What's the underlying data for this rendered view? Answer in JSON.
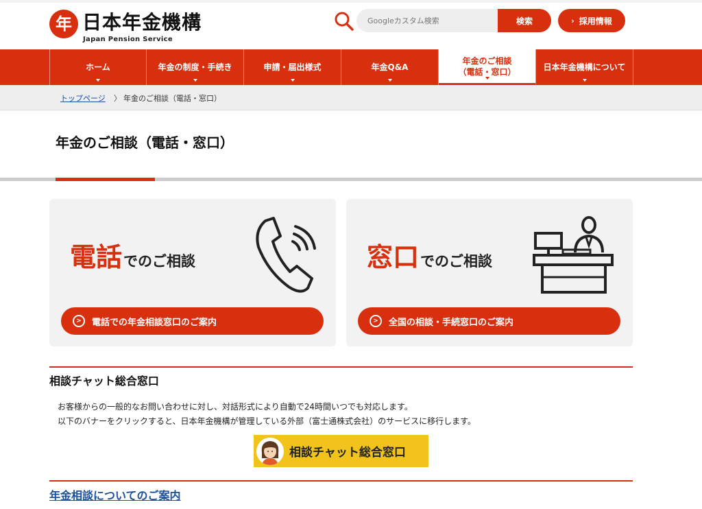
{
  "header": {
    "logo_text": "日本年金機構",
    "logo_text_en": "Japan Pension Service",
    "logo_mark_char": "年",
    "search_placeholder": "Googleカスタム検索",
    "search_button": "検索",
    "recruit_button": "採用情報"
  },
  "nav": {
    "items": [
      {
        "label": "ホーム"
      },
      {
        "label": "年金の制度・手続き"
      },
      {
        "label": "申請・届出様式"
      },
      {
        "label": "年金Q&A"
      },
      {
        "label": "年金のご相談",
        "label2": "（電話・窓口）"
      },
      {
        "label": "日本年金機構について"
      }
    ]
  },
  "breadcrumb": {
    "home": "トップページ",
    "separator": "〉",
    "current": "年金のご相談（電話・窓口）"
  },
  "page": {
    "title": "年金のご相談（電話・窓口）"
  },
  "cards": {
    "telephone": {
      "heading_big": "電話",
      "heading_small": "でのご相談",
      "button": "電話での年金相談窓口のご案内"
    },
    "window": {
      "heading_big": "窓口",
      "heading_small": "でのご相談",
      "button": "全国の相談・手続窓口のご案内"
    }
  },
  "chat": {
    "title": "相談チャット総合窓口",
    "text1": "お客様からの一般的なお問い合わせに対し、対話形式により自動で24時間いつでも対応します。",
    "text2": "以下のバナーをクリックすると、日本年金機構が管理している外部（富士通株式会社）のサービスに移行します。",
    "banner_label": "相談チャット総合窓口"
  },
  "consult": {
    "link": "年金相談についてのご案内"
  },
  "colors": {
    "brand": "#d8300e",
    "link": "#1a4fa0",
    "banner": "#f2c41b"
  }
}
